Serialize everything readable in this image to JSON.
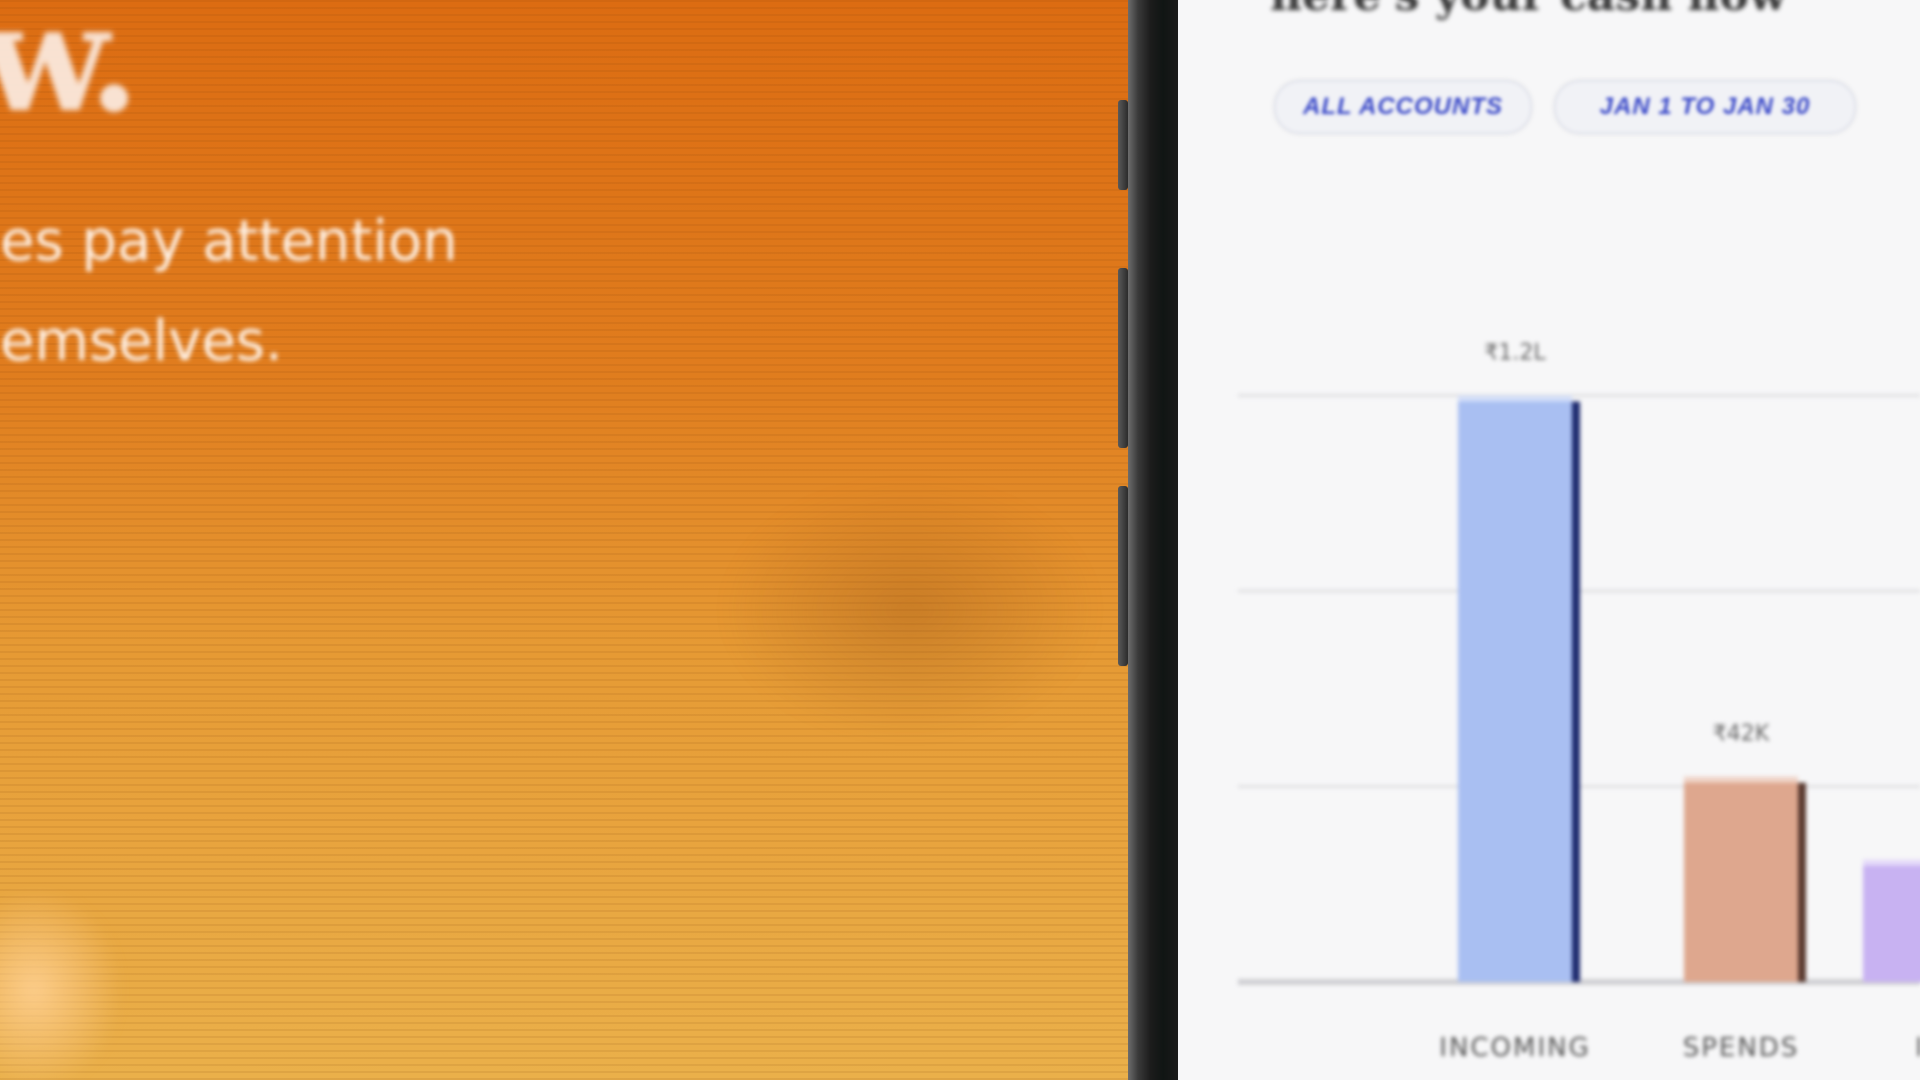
{
  "promo": {
    "logo_glyph": "w.",
    "tagline_lines": [
      "es pay attention",
      "emselves."
    ]
  },
  "screen": {
    "title": "here's your cash flow",
    "filters": {
      "accounts_label": "ALL ACCOUNTS",
      "date_label": "JAN 1 TO JAN 30"
    }
  },
  "colors": {
    "incoming": "#a9bff2",
    "incoming_edge": "#1d2a6e",
    "spends": "#dea78e",
    "spends_edge": "#5a3a30",
    "third": "#c8b2f2",
    "accent": "#3948c8"
  },
  "chart_data": {
    "type": "bar",
    "categories": [
      "INCOMING",
      "SPENDS",
      "I"
    ],
    "values": [
      1.2,
      0.42,
      0.25
    ],
    "value_labels": [
      "₹1.2L",
      "₹42K",
      ""
    ],
    "ylim": [
      0,
      1.6
    ],
    "grid": true
  }
}
